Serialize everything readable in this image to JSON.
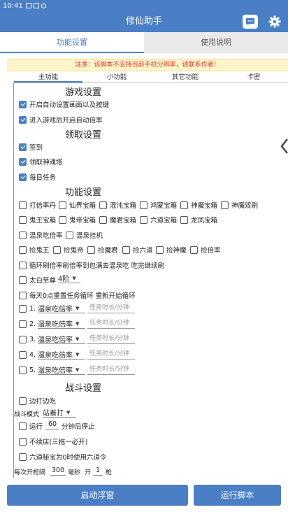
{
  "status_bar": {
    "time": "10:41"
  },
  "app_bar": {
    "title": "修仙助手",
    "icons": [
      "chat-icon",
      "gear-icon"
    ]
  },
  "main_tabs": [
    {
      "label": "功能设置",
      "active": true
    },
    {
      "label": "使用说明",
      "active": false
    }
  ],
  "notice": "注意：该脚本不支持当前手机分辨率，请联系作者！",
  "sub_tabs": [
    {
      "label": "主功能",
      "active": true
    },
    {
      "label": "小功能"
    },
    {
      "label": "其它功能"
    },
    {
      "label": "卡密"
    }
  ],
  "sections": {
    "game": {
      "title": "游戏设置",
      "items": [
        {
          "label": "开启自动设置画面以及按键",
          "checked": true
        },
        {
          "label": "进入游戏后开启自动倍率",
          "checked": true
        }
      ]
    },
    "collect": {
      "title": "领取设置",
      "items": [
        {
          "label": "签到",
          "checked": true
        },
        {
          "label": "领取神魂塔",
          "checked": true
        },
        {
          "label": "每日任务",
          "checked": true
        }
      ]
    },
    "function": {
      "title": "功能设置",
      "row1": [
        "打倍率丹",
        "仙界宝箱",
        "混沌宝箱",
        "鸿蒙宝箱",
        "神魔宝箱",
        "神魔双刷"
      ],
      "row2": [
        "鬼王宝箱",
        "鬼帝宝箱",
        "魔君宝箱",
        "六道宝箱",
        "龙凤宝箱"
      ],
      "row3": [
        "温泉吃倍率",
        "温泉挂机"
      ],
      "row4": [
        "捡鬼王",
        "捡鬼帝",
        "捡魔君",
        "捡六道",
        "捡神魔",
        "捡倍率"
      ],
      "loop_label": "循环刷倍率刷倍率到包满去温泉吃 吃完继续刷",
      "taibai_label": "太白至尊",
      "taibai_value": "4阶",
      "daily_label": "每天0点重置任务循环 重新开始循环",
      "hot_spring_rows": [
        {
          "index": "1.",
          "value": "温泉吃倍率",
          "placeholder": "任务时长/分钟"
        },
        {
          "index": "2.",
          "value": "温泉吃倍率",
          "placeholder": "任务时长/分钟"
        },
        {
          "index": "3.",
          "value": "温泉吃倍率",
          "placeholder": "任务时长/分钟"
        },
        {
          "index": "4.",
          "value": "温泉吃倍率",
          "placeholder": "任务时长/分钟"
        },
        {
          "index": "5.",
          "value": "温泉吃倍率",
          "placeholder": "任务时长/分钟"
        }
      ]
    },
    "battle": {
      "title": "战斗设置",
      "dodge_label": "边打边吃",
      "mode_label": "战斗模式",
      "mode_value": "站着打",
      "run_label": "运行",
      "run_value": "60",
      "run_suffix": "分钟后停止",
      "no_revive_label": "不续店(三拖一必开)",
      "six_label": "六道秘宝为0时使用六道令",
      "fire_prefix": "每次开枪隔",
      "fire_value": "300",
      "fire_unit": "毫秒",
      "fire_mid": "开",
      "fire_count": "1",
      "fire_suffix": "枪"
    }
  },
  "buttons": {
    "float": "启动浮窗",
    "run": "运行脚本"
  },
  "colors": {
    "primary": "#4a7fc6",
    "notice_bg": "#fdf5c8",
    "notice_text": "#ee3333"
  }
}
